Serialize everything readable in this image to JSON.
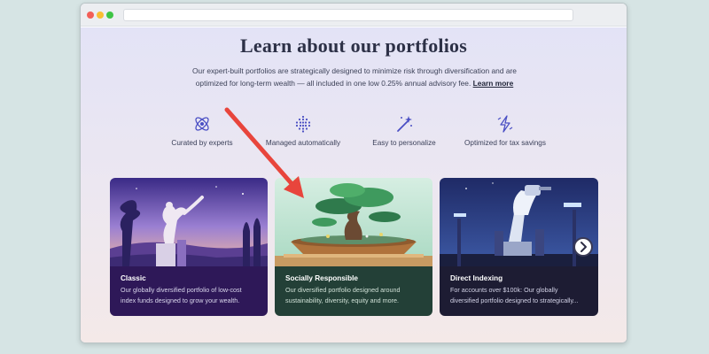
{
  "browser": {
    "controls": [
      "close",
      "minimize",
      "maximize"
    ],
    "url": ""
  },
  "page": {
    "title": "Learn about our portfolios",
    "intro_text": "Our expert-built portfolios are strategically designed to minimize risk through diversification and are optimized for long-term wealth — all included in one low 0.25% annual advisory fee.",
    "learn_more_label": "Learn more"
  },
  "features": [
    {
      "label": "Curated by experts",
      "icon": "atom-icon"
    },
    {
      "label": "Managed automatically",
      "icon": "dot-grid-icon"
    },
    {
      "label": "Easy to personalize",
      "icon": "magic-wand-icon"
    },
    {
      "label": "Optimized for tax savings",
      "icon": "lightning-icon"
    }
  ],
  "cards": [
    {
      "title": "Classic",
      "description": "Our globally diversified portfolio of low-cost index funds designed to grow your wealth.",
      "image": "discus-thrower-statue-illustration"
    },
    {
      "title": "Socially Responsible",
      "description": "Our diversified portfolio designed around sustainability, diversity, equity and more.",
      "image": "bonsai-tree-illustration"
    },
    {
      "title": "Direct Indexing",
      "description": "For accounts over $100k: Our globally diversified portfolio designed to strategically...",
      "image": "robotic-arm-illustration"
    }
  ],
  "carousel": {
    "next_icon": "chevron-right-icon"
  },
  "annotation": {
    "type": "red-arrow",
    "color": "#e8453c",
    "points_to": "Socially Responsible"
  },
  "colors": {
    "accent": "#4a4fc4",
    "classic_card": "#2e1858",
    "socially_responsible_card": "#234037",
    "direct_indexing_card": "#1d1c33"
  }
}
